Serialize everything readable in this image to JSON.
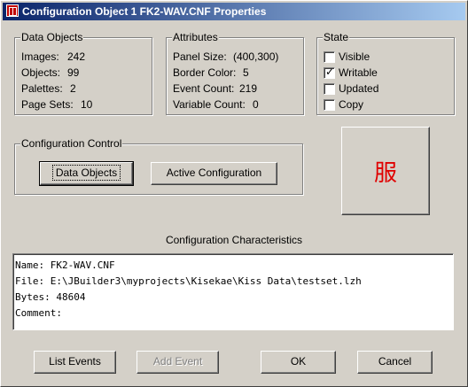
{
  "window": {
    "title": "Configuration Object 1 FK2-WAV.CNF Properties",
    "icon": "app-icon"
  },
  "data_objects": {
    "label": "Data Objects",
    "rows": [
      {
        "label": "Images:",
        "value": "242"
      },
      {
        "label": "Objects:",
        "value": "99"
      },
      {
        "label": "Palettes:",
        "value": "2"
      },
      {
        "label": "Page Sets:",
        "value": "10"
      }
    ]
  },
  "attributes": {
    "label": "Attributes",
    "rows": [
      {
        "label": "Panel Size:",
        "value": "(400,300)"
      },
      {
        "label": "Border Color:",
        "value": "5"
      },
      {
        "label": "Event Count:",
        "value": "219"
      },
      {
        "label": "Variable Count:",
        "value": "0"
      }
    ]
  },
  "state": {
    "label": "State",
    "items": [
      {
        "label": "Visible",
        "checked": false
      },
      {
        "label": "Writable",
        "checked": true
      },
      {
        "label": "Updated",
        "checked": false
      },
      {
        "label": "Copy",
        "checked": false
      }
    ]
  },
  "config_control": {
    "label": "Configuration Control",
    "data_objects_button": "Data Objects",
    "active_configuration_button": "Active Configuration"
  },
  "preview": {
    "glyph": "服",
    "color": "#e00000"
  },
  "characteristics": {
    "heading": "Configuration Characteristics",
    "lines": [
      "Name: FK2-WAV.CNF",
      "File: E:\\JBuilder3\\myprojects\\Kisekae\\Kiss Data\\testset.lzh",
      "Bytes: 48604",
      "Comment:"
    ]
  },
  "footer": {
    "list_events": "List Events",
    "add_event": "Add Event",
    "ok": "OK",
    "cancel": "Cancel"
  }
}
